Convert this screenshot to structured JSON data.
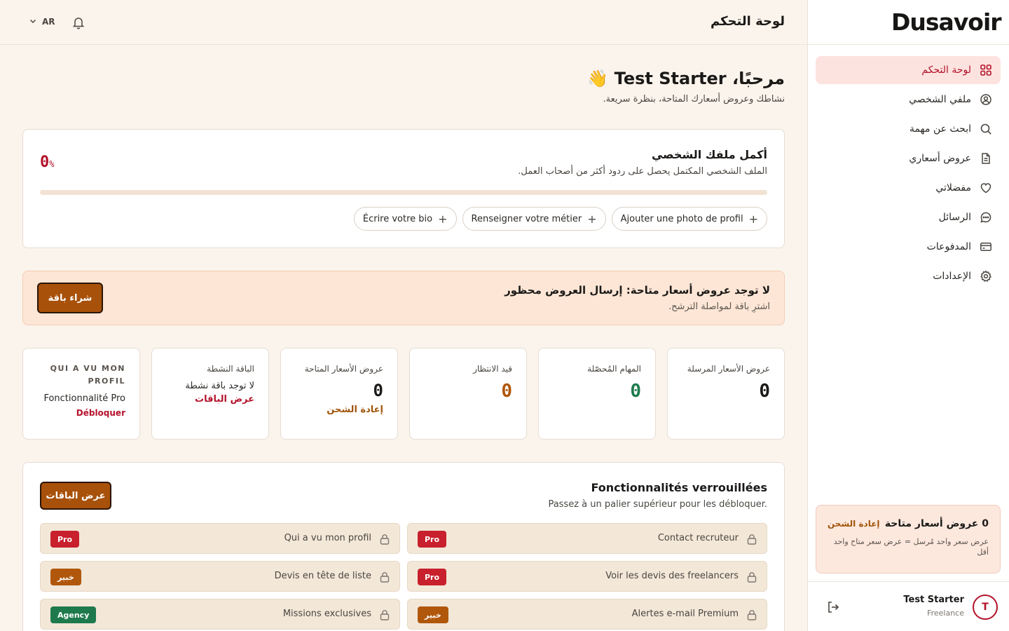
{
  "colors": {
    "accent": "#b3122a",
    "brand_orange": "#a8510a",
    "green": "#1e7a4c",
    "amber": "#b0570b"
  },
  "sidebar": {
    "logo": "Dusavoir",
    "items": [
      {
        "label": "لوحة التحكم",
        "icon": "grid-icon",
        "active": true
      },
      {
        "label": "ملفي الشخصي",
        "icon": "user-circle-icon"
      },
      {
        "label": "ابحث عن مهمة",
        "icon": "search-icon"
      },
      {
        "label": "عروض أسعاري",
        "icon": "document-icon"
      },
      {
        "label": "مفضلاتي",
        "icon": "heart-icon"
      },
      {
        "label": "الرسائل",
        "icon": "chat-icon"
      },
      {
        "label": "المدفوعات",
        "icon": "credit-card-icon"
      },
      {
        "label": "الإعدادات",
        "icon": "gear-icon"
      }
    ],
    "credits": {
      "title": "0 عروض أسعار متاحة",
      "link": "إعادة الشحن",
      "note": "عرض سعر واحد مُرسل = عرض سعر متاح واحد أقل"
    },
    "user": {
      "initial": "T",
      "name": "Test Starter",
      "role": "Freelance"
    }
  },
  "topbar": {
    "title": "لوحة التحكم",
    "lang": "AR"
  },
  "welcome": {
    "title": "مرحبًا، Test Starter 👋",
    "subtitle": "نشاطك وعروض أسعارك المتاحة، بنظرة سريعة."
  },
  "profile": {
    "title": "أكمل ملفك الشخصي",
    "subtitle": "الملف الشخصي المكتمل يحصل على ردود أكثر من أصحاب العمل.",
    "percent": "0",
    "percent_sign": "%",
    "progress": 0,
    "chips": [
      "Ajouter une photo de profil",
      "Renseigner votre métier",
      "Écrire votre bio"
    ]
  },
  "alert": {
    "title": "لا توجد عروض أسعار متاحة: إرسال العروض محظور",
    "subtitle": "اشترِ باقة لمواصلة الترشح.",
    "button": "شراء باقة"
  },
  "stats": [
    {
      "label": "عروض الأسعار المرسلة",
      "value": "0"
    },
    {
      "label": "المهام المُحصّلة",
      "value": "0"
    },
    {
      "label": "قيد الانتظار",
      "value": "0"
    },
    {
      "label": "عروض الأسعار المتاحة",
      "value": "0",
      "link": "إعادة الشحن"
    },
    {
      "label": "الباقة النشطة",
      "text": "لا توجد باقة نشطة",
      "link": "عرض الباقات"
    },
    {
      "label": "QUI A VU MON PROFIL",
      "text": "Fonctionnalité Pro",
      "link": "Débloquer"
    }
  ],
  "locked": {
    "title": "Fonctionnalités verrouillées",
    "subtitle": "Passez à un palier supérieur pour les débloquer.",
    "button": "عرض الباقات",
    "features": [
      {
        "name": "Contact recruteur",
        "badge": "Pro"
      },
      {
        "name": "Qui a vu mon profil",
        "badge": "Pro"
      },
      {
        "name": "Voir les devis des freelancers",
        "badge": "Pro"
      },
      {
        "name": "Devis en tête de liste",
        "badge": "خبير"
      },
      {
        "name": "Alertes e-mail Premium",
        "badge": "خبير"
      },
      {
        "name": "Missions exclusives",
        "badge": "Agency"
      }
    ]
  }
}
